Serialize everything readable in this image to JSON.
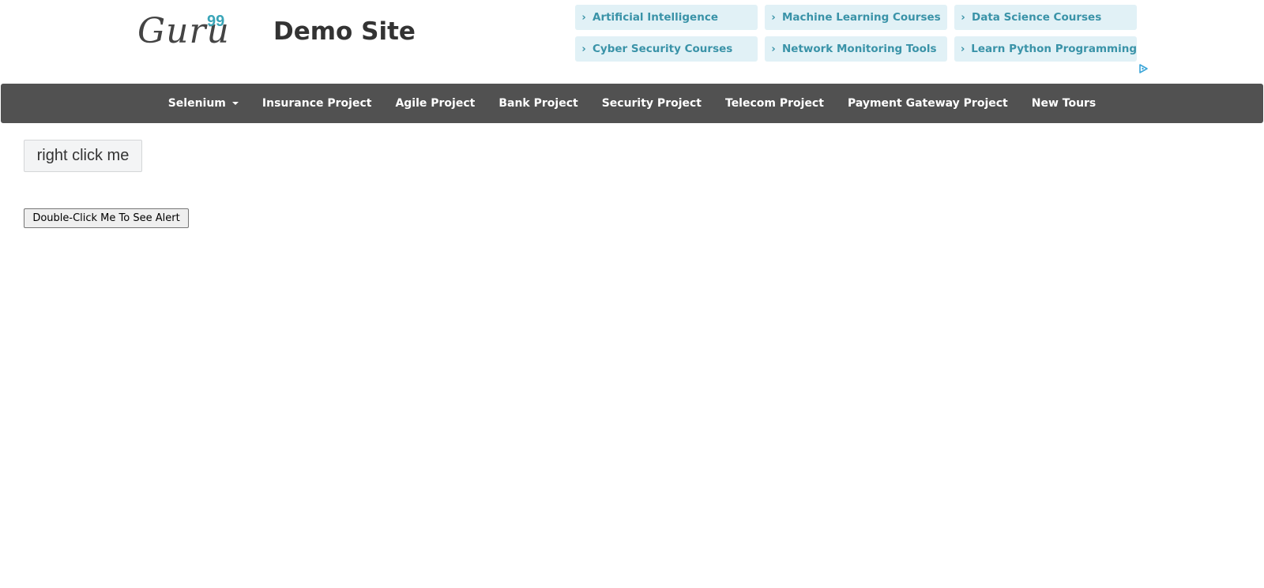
{
  "header": {
    "logo_text": "Guru",
    "logo_superscript": "99",
    "site_title": "Demo Site"
  },
  "ads": {
    "links": [
      "Artificial Intelligence",
      "Machine Learning Courses",
      "Data Science Courses",
      "Cyber Security Courses",
      "Network Monitoring Tools",
      "Learn Python Programming"
    ],
    "chevron": "›",
    "marker_icon": "adchoices-triangle-icon",
    "accent_color": "#3a93a8",
    "background_color": "#e1f1f6"
  },
  "nav": {
    "items": [
      "Selenium",
      "Insurance Project",
      "Agile Project",
      "Bank Project",
      "Security Project",
      "Telecom Project",
      "Payment Gateway Project",
      "New Tours"
    ],
    "background_color": "#515151"
  },
  "main": {
    "right_click_label": "right click me",
    "double_click_label": "Double-Click Me To See Alert"
  }
}
